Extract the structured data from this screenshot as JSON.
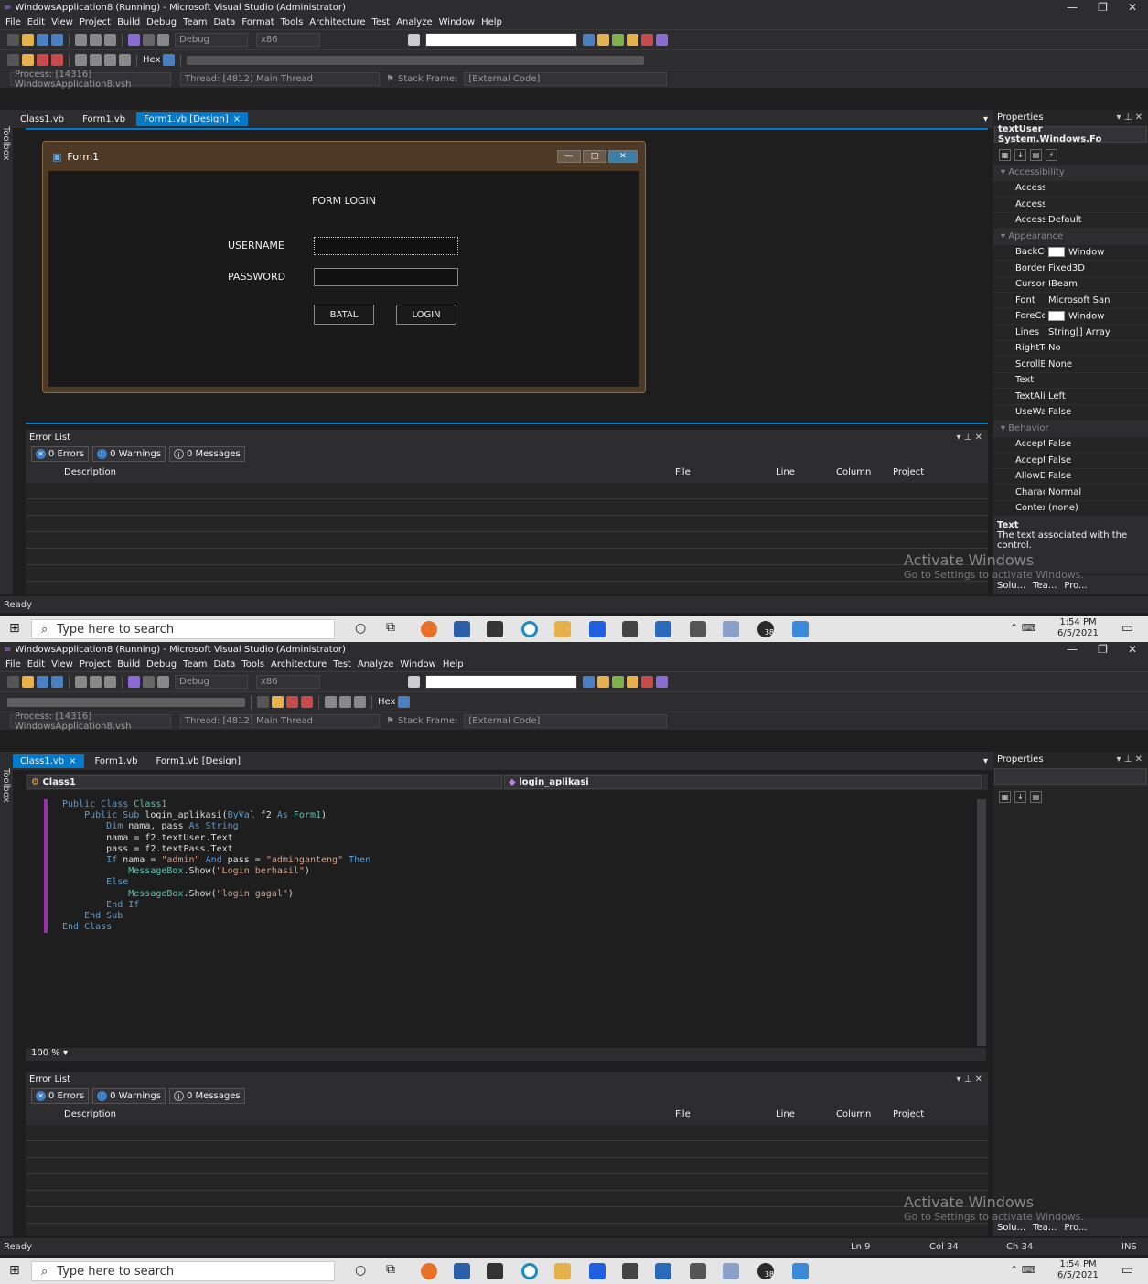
{
  "window": {
    "title": "WindowsApplication8 (Running) - Microsoft Visual Studio (Administrator)",
    "menu": [
      "File",
      "Edit",
      "View",
      "Project",
      "Build",
      "Debug",
      "Team",
      "Data",
      "Format",
      "Tools",
      "Architecture",
      "Test",
      "Analyze",
      "Window",
      "Help"
    ],
    "menu_code": [
      "File",
      "Edit",
      "View",
      "Project",
      "Build",
      "Debug",
      "Team",
      "Data",
      "Tools",
      "Architecture",
      "Test",
      "Analyze",
      "Window",
      "Help"
    ],
    "config": "Debug",
    "platform": "x86",
    "hex_label": "Hex",
    "process": "Process: [14316] WindowsApplication8.vsh",
    "thread": "Thread: [4812] Main Thread",
    "stack_frame_label": "Stack Frame:",
    "stack_frame": "[External Code]",
    "toolbox": "Toolbox"
  },
  "screen1": {
    "tabs": [
      {
        "label": "Class1.vb"
      },
      {
        "label": "Form1.vb"
      },
      {
        "label": "Form1.vb [Design]",
        "close": "×"
      }
    ],
    "form": {
      "title": "Form1",
      "heading": "FORM LOGIN",
      "username_label": "USERNAME",
      "password_label": "PASSWORD",
      "cancel_button": "BATAL",
      "login_button": "LOGIN"
    },
    "properties": {
      "title": "Properties",
      "selected": "textUser System.Windows.Fo",
      "rows": [
        {
          "type": "cat",
          "name": "Accessibility"
        },
        {
          "name": "Accessibl",
          "value": ""
        },
        {
          "name": "Accessibl",
          "value": ""
        },
        {
          "name": "Accessibl",
          "value": "Default"
        },
        {
          "type": "cat",
          "name": "Appearance"
        },
        {
          "name": "BackColor",
          "value": "Window",
          "swatch": "#ffffff"
        },
        {
          "name": "BorderStyl",
          "value": "Fixed3D"
        },
        {
          "name": "Cursor",
          "value": "IBeam"
        },
        {
          "name": "Font",
          "value": "Microsoft San"
        },
        {
          "name": "ForeColor",
          "value": "Window",
          "swatch": "#ffffff"
        },
        {
          "name": "Lines",
          "value": "String[] Array"
        },
        {
          "name": "RightToLef",
          "value": "No"
        },
        {
          "name": "ScrollBars",
          "value": "None"
        },
        {
          "name": "Text",
          "value": ""
        },
        {
          "name": "TextAlign",
          "value": "Left"
        },
        {
          "name": "UseWaitCu",
          "value": "False"
        },
        {
          "type": "cat",
          "name": "Behavior"
        },
        {
          "name": "AcceptsRe",
          "value": "False"
        },
        {
          "name": "AcceptsTal",
          "value": "False"
        },
        {
          "name": "AllowDrop",
          "value": "False"
        },
        {
          "name": "CharacterC",
          "value": "Normal"
        },
        {
          "name": "ContextMe",
          "value": "(none)"
        }
      ],
      "desc_title": "Text",
      "desc_body": "The text associated with the control."
    }
  },
  "screen2": {
    "tabs": [
      {
        "label": "Class1.vb",
        "close": "×"
      },
      {
        "label": "Form1.vb"
      },
      {
        "label": "Form1.vb [Design]"
      }
    ],
    "nav_left": "Class1",
    "nav_right": "login_aplikasi",
    "code_lines": [
      [
        [
          "kw",
          "Public Class "
        ],
        [
          "ty",
          "Class1"
        ]
      ],
      [
        [
          "pl",
          "    "
        ],
        [
          "kw",
          "Public Sub "
        ],
        [
          "pl",
          "login_aplikasi("
        ],
        [
          "kw",
          "ByVal "
        ],
        [
          "pl",
          "f2 "
        ],
        [
          "kw",
          "As "
        ],
        [
          "ty",
          "Form1"
        ],
        [
          "pl",
          ")"
        ]
      ],
      [
        [
          "pl",
          "        "
        ],
        [
          "kw",
          "Dim "
        ],
        [
          "pl",
          "nama, pass "
        ],
        [
          "kw",
          "As String"
        ]
      ],
      [
        [
          "pl",
          "        nama = f2.textUser.Text"
        ]
      ],
      [
        [
          "pl",
          "        pass = f2.textPass.Text"
        ]
      ],
      [
        [
          "pl",
          "        "
        ],
        [
          "kw",
          "If "
        ],
        [
          "pl",
          "nama = "
        ],
        [
          "str",
          "\"admin\""
        ],
        [
          "kw",
          " And "
        ],
        [
          "pl",
          "pass = "
        ],
        [
          "str",
          "\"adminganteng\""
        ],
        [
          "kw",
          " Then"
        ]
      ],
      [
        [
          "pl",
          "            "
        ],
        [
          "ty",
          "MessageBox"
        ],
        [
          "pl",
          ".Show("
        ],
        [
          "str",
          "\"Login berhasil\""
        ],
        [
          "pl",
          ")"
        ]
      ],
      [
        [
          "pl",
          "        "
        ],
        [
          "kw",
          "Else"
        ]
      ],
      [
        [
          "pl",
          "            "
        ],
        [
          "ty",
          "MessageBox"
        ],
        [
          "pl",
          ".Show("
        ],
        [
          "str",
          "\"login gagal\""
        ],
        [
          "pl",
          ")"
        ]
      ],
      [
        [
          "pl",
          "        "
        ],
        [
          "kw",
          "End If"
        ]
      ],
      [
        [
          "pl",
          "    "
        ],
        [
          "kw",
          "End Sub"
        ]
      ],
      [
        [
          "kw",
          "End Class"
        ]
      ]
    ],
    "zoom": "100 %",
    "status": {
      "ready": "Ready",
      "ln": "Ln 9",
      "col": "Col 34",
      "ch": "Ch 34",
      "ins": "INS"
    }
  },
  "error_list": {
    "title": "Error List",
    "errors": "0 Errors",
    "warnings": "0 Warnings",
    "messages": "0 Messages",
    "columns": [
      "Description",
      "File",
      "Line",
      "Column",
      "Project"
    ]
  },
  "bottom_tabs": [
    "Solu...",
    "Tea...",
    "Pro..."
  ],
  "activate": {
    "title": "Activate Windows",
    "sub": "Go to Settings to activate Windows."
  },
  "status_ready": "Ready",
  "taskbar": {
    "search": "Type here to search",
    "time": "1:54 PM",
    "date": "6/5/2021",
    "badge": "38"
  }
}
